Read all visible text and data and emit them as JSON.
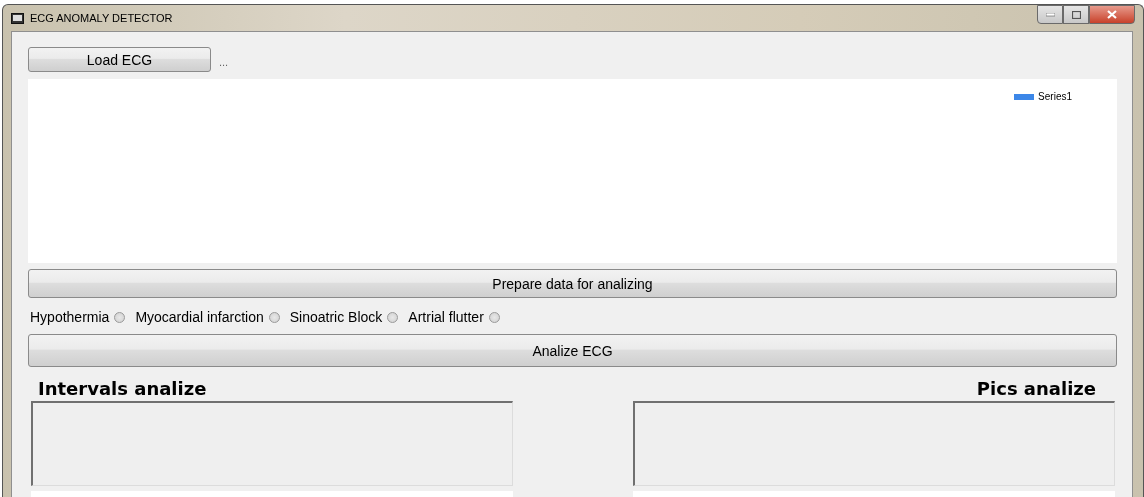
{
  "window": {
    "title": "ECG ANOMALY DETECTOR"
  },
  "load_button": {
    "label": "Load ECG"
  },
  "file_label": "...",
  "chart": {
    "legend": [
      {
        "name": "Series1",
        "color": "#3c87e8"
      }
    ]
  },
  "prepare_button": {
    "label": "Prepare data for analizing"
  },
  "anomalies": [
    {
      "label": "Hypothermia",
      "selected": false
    },
    {
      "label": "Myocardial infarction",
      "selected": false
    },
    {
      "label": "Sinoatric Block",
      "selected": false
    },
    {
      "label": "Artrial flutter",
      "selected": false
    }
  ],
  "analyze_button": {
    "label": "Analize ECG"
  },
  "panels": [
    {
      "heading": "Intervals analize",
      "kind": "left"
    },
    {
      "heading": "Pics analize",
      "kind": "right"
    }
  ]
}
